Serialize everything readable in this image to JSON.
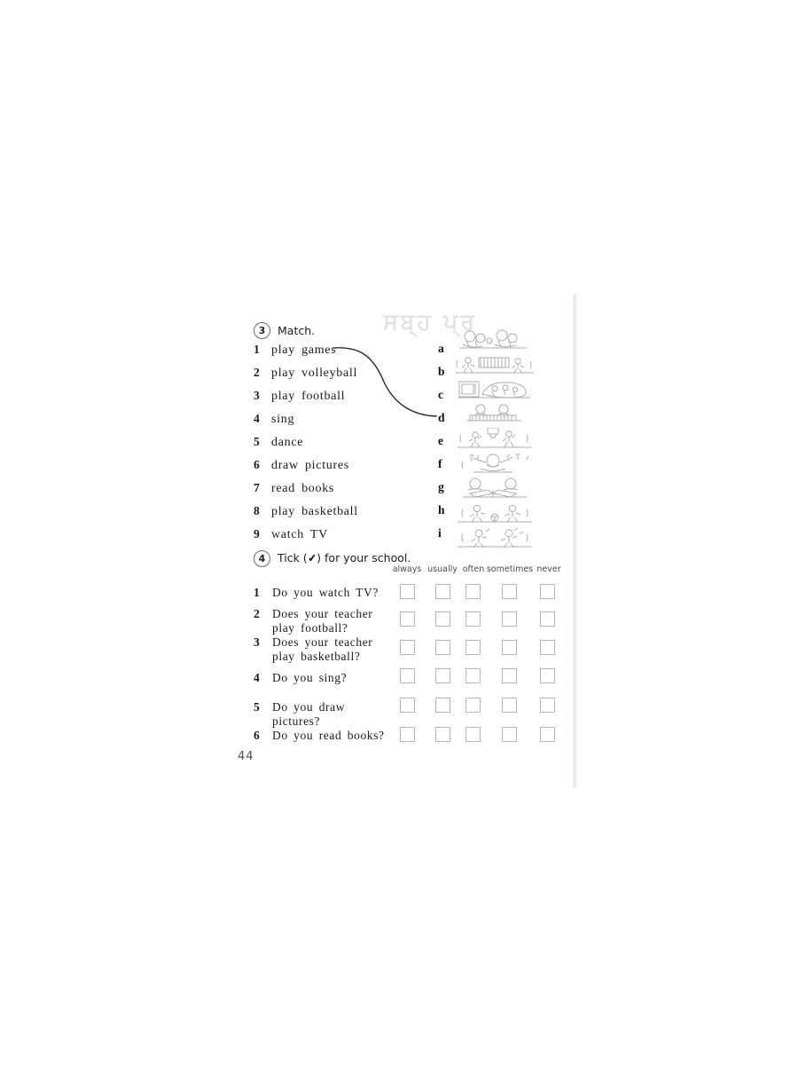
{
  "page": {
    "number": "44",
    "bleed_through_ghost": "ਸਬ੍ਹ ਪ੍ਰ"
  },
  "exercise3": {
    "badge": "3",
    "title": "Match.",
    "items": [
      {
        "num": "1",
        "label": "play  games",
        "letter": "a"
      },
      {
        "num": "2",
        "label": "play  volleyball",
        "letter": "b"
      },
      {
        "num": "3",
        "label": "play  football",
        "letter": "c"
      },
      {
        "num": "4",
        "label": "sing",
        "letter": "d"
      },
      {
        "num": "5",
        "label": "dance",
        "letter": "e"
      },
      {
        "num": "6",
        "label": "draw  pictures",
        "letter": "f"
      },
      {
        "num": "7",
        "label": "read  books",
        "letter": "g"
      },
      {
        "num": "8",
        "label": "play  basketball",
        "letter": "h"
      },
      {
        "num": "9",
        "label": "watch  TV",
        "letter": "i"
      }
    ],
    "drawn_connection": {
      "from_item": "1",
      "to_letter": "d"
    },
    "illustrations": [
      {
        "letter": "a",
        "caption": "children playing games outdoors"
      },
      {
        "letter": "b",
        "caption": "children playing volleyball over a net"
      },
      {
        "letter": "c",
        "caption": "children watching TV / television set"
      },
      {
        "letter": "d",
        "caption": "children singing at a piano"
      },
      {
        "letter": "e",
        "caption": "children playing basketball at a hoop"
      },
      {
        "letter": "f",
        "caption": "child dancing with music notes"
      },
      {
        "letter": "g",
        "caption": "two children reading books at a table"
      },
      {
        "letter": "h",
        "caption": "children playing football with a ball"
      },
      {
        "letter": "i",
        "caption": "two children drawing pictures"
      }
    ]
  },
  "exercise4": {
    "badge": "4",
    "title_before": "Tick  (",
    "title_tick": "✔",
    "title_after": ")  for  your  school.",
    "columns": [
      "always",
      "usually",
      "often",
      "sometimes",
      "never"
    ],
    "questions": [
      {
        "num": "1",
        "text": "Do  you  watch  TV?"
      },
      {
        "num": "2",
        "text": "Does  your  teacher\nplay  football?"
      },
      {
        "num": "3",
        "text": "Does  your  teacher\nplay  basketball?"
      },
      {
        "num": "4",
        "text": "Do  you  sing?"
      },
      {
        "num": "5",
        "text": "Do  you  draw\npictures?"
      },
      {
        "num": "6",
        "text": "Do  you  read  books?"
      }
    ],
    "checkbox_state": "all-empty"
  },
  "colors": {
    "ink": "#1a1a1a",
    "checkbox_border": "#b6b6b6",
    "bubble_border": "#6a6a6a",
    "page_background": "#ffffff",
    "illustration_pencil": "#8f8f8f"
  }
}
